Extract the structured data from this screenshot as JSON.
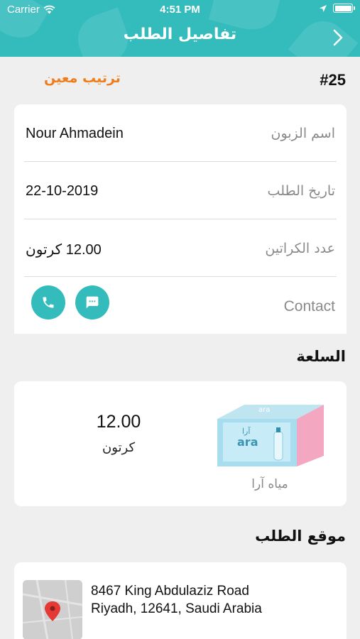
{
  "status_bar": {
    "carrier": "Carrier",
    "time": "4:51 PM"
  },
  "nav": {
    "title": "تفاصيل الطلب",
    "back_icon": "chevron-right-icon"
  },
  "order": {
    "number": "#25",
    "status": "ترتيب معين"
  },
  "info": {
    "customer_label": "اسم الزبون",
    "customer_value": "Nour Ahmadein",
    "date_label": "تاريخ الطلب",
    "date_value": "22-10-2019",
    "cartons_label": "عدد الكراتين",
    "cartons_value": "12.00 كرتون",
    "contact_label": "Contact"
  },
  "product_section": {
    "title": "السلعة",
    "name": "مياه آرا",
    "quantity": "12.00",
    "unit": "كرتون",
    "box_brand": "ara",
    "box_brand_ar": "آرا"
  },
  "location_section": {
    "title": "موقع الطلب",
    "address_line1": "8467 King Abdulaziz Road",
    "address_line2": "Riyadh, 12641, Saudi Arabia"
  },
  "colors": {
    "primary": "#34bcbc",
    "accent_orange": "#f07d1b",
    "background": "#efefef"
  }
}
